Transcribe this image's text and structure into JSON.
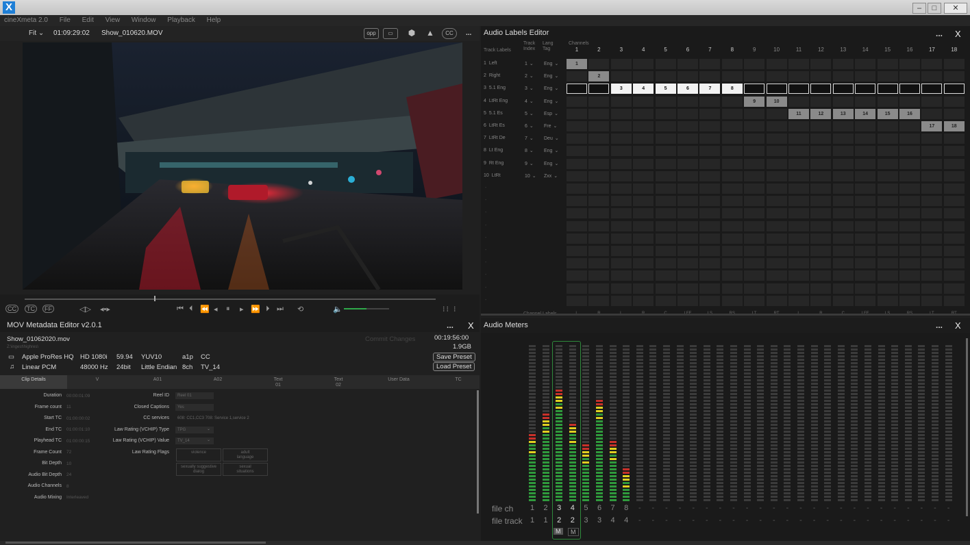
{
  "app": {
    "logo": "X",
    "menu": [
      "cineXmeta 2.0",
      "File",
      "Edit",
      "View",
      "Window",
      "Playback",
      "Help"
    ]
  },
  "video": {
    "fit": "Fit",
    "timecode": "01:09:29:02",
    "filename": "Show_010620.MOV",
    "toolbar_icons": [
      "opp-icon",
      "caption-box-icon",
      "eraser-icon",
      "chart-icon",
      "cc-icon"
    ],
    "toolbar_labels": [
      "opp",
      "CC"
    ],
    "transport_left": [
      "CC",
      "TC",
      "FF"
    ],
    "transport_extra": "⁝⁝ ⁝",
    "volume_fraction": 0.5
  },
  "md": {
    "title": "MOV Metadata Editor  v2.0.1",
    "file": "Show_01062020.mov",
    "path": "Z:\\ingest\\highres\\",
    "duration": "00:19:56:00",
    "size": "1.9GB",
    "commit": "Commit Changes",
    "save": "Save Preset",
    "load": "Load Preset",
    "video_line": [
      "Apple ProRes HQ",
      "HD 1080i",
      "59.94",
      "YUV10",
      "a1p",
      "CC"
    ],
    "audio_line": [
      "Linear PCM",
      "48000 Hz",
      "24bit",
      "Little Endian",
      "8ch",
      "TV_14"
    ],
    "tabs": [
      "Clip Details",
      "V",
      "A01",
      "A02",
      "Text\n01",
      "Text\n02",
      "User Data",
      "TC"
    ],
    "left_fields": [
      [
        "Duration",
        "00:00:01:09"
      ],
      [
        "Frame count",
        "11"
      ],
      [
        "Start TC",
        "01:00:00:02"
      ],
      [
        "End TC",
        "01:00:01:10"
      ],
      [
        "Playhead TC",
        "01:00:00:15"
      ],
      [
        "Frame Count",
        "72"
      ],
      [
        "Bit Depth",
        "10"
      ],
      [
        "Audio Bit Depth",
        "24"
      ],
      [
        "Audio Channels",
        "8"
      ],
      [
        "Audio Mixing",
        "Interleaved"
      ]
    ],
    "right_fields": [
      [
        "Reel ID",
        "Reel 01"
      ],
      [
        "Closed Captions",
        "Yes"
      ],
      [
        "CC services",
        "608: CC1,CC3 708: Service 1,service 2"
      ],
      [
        "Law Rating (VCHIP) Type",
        "TPG"
      ],
      [
        "Law Rating (VCHIP) Value",
        "TV_14"
      ],
      [
        "Law Rating Flags",
        ""
      ]
    ],
    "flags": [
      "violence",
      "adult\nlanguage",
      "sexually suggestive\ndialog",
      "sexual\nsituations"
    ]
  },
  "ale": {
    "title": "Audio Labels Editor",
    "headers": [
      "Track Labels",
      "Track\nIndex",
      "Lang\nTag",
      "Channels"
    ],
    "tracks": [
      [
        "1",
        "Left",
        "1",
        "Eng"
      ],
      [
        "2",
        "Right",
        "2",
        "Eng"
      ],
      [
        "3",
        "5.1 Eng",
        "3",
        "Eng"
      ],
      [
        "4",
        "LtRt Eng",
        "4",
        "Eng"
      ],
      [
        "5",
        "5.1 Es",
        "5",
        "Esp"
      ],
      [
        "6",
        "LtRt Es",
        "6",
        "Fre"
      ],
      [
        "7",
        "LtRt De",
        "7",
        "Deu"
      ],
      [
        "8",
        "Lt Eng",
        "8",
        "Eng"
      ],
      [
        "9",
        "Rt Eng",
        "9",
        "Eng"
      ],
      [
        "10",
        "LtRt",
        "10",
        "Zxx"
      ]
    ],
    "channels": [
      "1",
      "2",
      "3",
      "4",
      "5",
      "6",
      "7",
      "8",
      "9",
      "10",
      "11",
      "12",
      "13",
      "14",
      "15",
      "16",
      "17",
      "18"
    ],
    "channel_labels_title": "Channel Labels",
    "channel_labels": [
      "L",
      "R",
      "L",
      "R",
      "C",
      "LFE",
      "LS",
      "RS",
      "LT",
      "RT",
      "L",
      "R",
      "C",
      "LFE",
      "LS",
      "RS",
      "LT",
      "RT"
    ],
    "assign": [
      [
        1,
        1
      ],
      [
        2,
        2
      ],
      [
        3,
        3
      ],
      [
        3,
        4
      ],
      [
        3,
        5
      ],
      [
        3,
        6
      ],
      [
        3,
        7
      ],
      [
        3,
        8
      ],
      [
        4,
        9
      ],
      [
        4,
        10
      ],
      [
        5,
        11
      ],
      [
        5,
        12
      ],
      [
        5,
        13
      ],
      [
        5,
        14
      ],
      [
        5,
        15
      ],
      [
        5,
        16
      ],
      [
        6,
        17
      ],
      [
        6,
        18
      ]
    ]
  },
  "meters": {
    "title": "Audio Meters",
    "file_ch_label": "file ch",
    "file_track_label": "file track",
    "file_ch": [
      "1",
      "2",
      "3",
      "4",
      "5",
      "6",
      "7",
      "8"
    ],
    "file_track": [
      "1",
      "1",
      "2",
      "2",
      "3",
      "3",
      "4",
      "4"
    ],
    "levels": [
      0.45,
      0.57,
      0.72,
      0.52,
      0.38,
      0.66,
      0.4,
      0.22
    ],
    "mute": [
      "M",
      "M"
    ],
    "dash": "-"
  },
  "colors": {
    "accent": "#1f7fd6",
    "meter_green": "#2f9a3c",
    "meter_yellow": "#e0d020",
    "meter_red": "#c8312a"
  }
}
